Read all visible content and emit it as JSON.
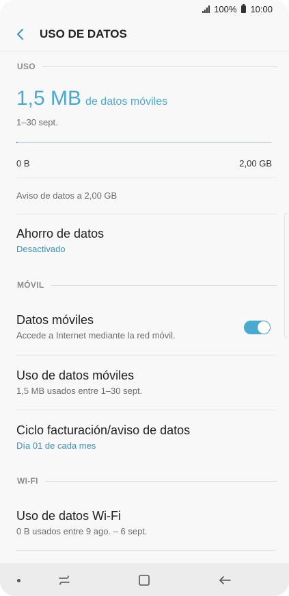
{
  "status_bar": {
    "battery": "100%",
    "time": "10:00"
  },
  "header": {
    "back_icon": "chevron-left-icon",
    "title": "USO DE DATOS"
  },
  "usage_section": {
    "heading": "USO",
    "amount": "1,5 MB",
    "amount_suffix": "de datos móviles",
    "date_range": "1–30 sept.",
    "progress_fraction": 0.0007,
    "axis_min": "0 B",
    "axis_max": "2,00 GB",
    "warning": "Aviso de datos a 2,00 GB"
  },
  "data_saver": {
    "title": "Ahorro de datos",
    "status": "Desactivado"
  },
  "mobile_section": {
    "heading": "MÓVIL",
    "mobile_data": {
      "title": "Datos móviles",
      "subtitle": "Accede a Internet mediante la red móvil.",
      "enabled": true
    },
    "mobile_usage": {
      "title": "Uso de datos móviles",
      "subtitle": "1,5 MB usados entre 1–30 sept."
    },
    "billing_cycle": {
      "title": "Ciclo facturación/aviso de datos",
      "subtitle": "Día 01 de cada mes"
    }
  },
  "wifi_section": {
    "heading": "WI-FI",
    "wifi_usage": {
      "title": "Uso de datos Wi-Fi",
      "subtitle": "0 B usados entre 9 ago. – 6 sept."
    }
  },
  "colors": {
    "accent": "#4aa9cf",
    "accent_text": "#3a92b6"
  },
  "nav_bar": {
    "icons": [
      "dot-icon",
      "recent-apps-icon",
      "home-icon",
      "back-arrow-icon"
    ]
  }
}
